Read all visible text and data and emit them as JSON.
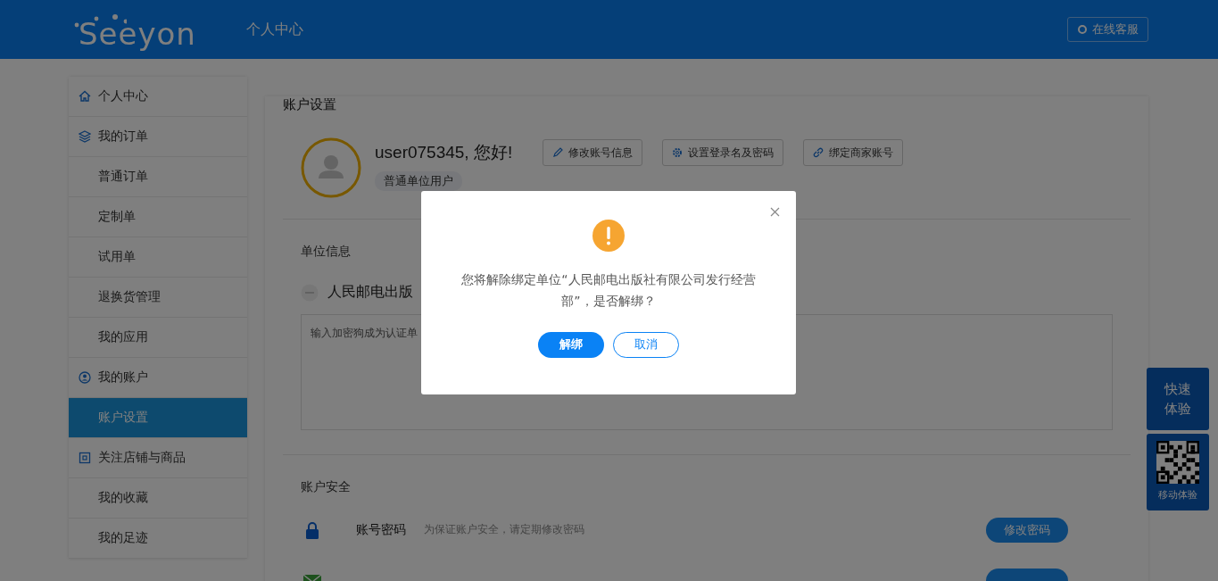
{
  "header": {
    "logo": "Seeyon",
    "title": "个人中心",
    "service_button": "在线客服"
  },
  "sidebar": {
    "items": [
      {
        "label": "个人中心",
        "kind": "group",
        "selected": false
      },
      {
        "label": "我的订单",
        "kind": "group",
        "selected": false
      },
      {
        "label": "普通订单",
        "kind": "item",
        "selected": false
      },
      {
        "label": "定制单",
        "kind": "item",
        "selected": false
      },
      {
        "label": "试用单",
        "kind": "item",
        "selected": false
      },
      {
        "label": "退换货管理",
        "kind": "item",
        "selected": false
      },
      {
        "label": "我的应用",
        "kind": "item",
        "selected": false
      },
      {
        "label": "我的账户",
        "kind": "group",
        "selected": false
      },
      {
        "label": "账户设置",
        "kind": "item",
        "selected": true
      },
      {
        "label": "关注店铺与商品",
        "kind": "group",
        "selected": false
      },
      {
        "label": "我的收藏",
        "kind": "item",
        "selected": false
      },
      {
        "label": "我的足迹",
        "kind": "item",
        "selected": false
      }
    ]
  },
  "account": {
    "title": "账户设置",
    "greeting": "user075345, 您好!",
    "role": "普通单位用户",
    "actions": [
      "修改账号信息",
      "设置登录名及密码",
      "绑定商家账号"
    ]
  },
  "unit": {
    "title": "单位信息",
    "name": "人民邮电出版",
    "dongle_hint": "输入加密狗成为认证单"
  },
  "security": {
    "title": "账户安全",
    "rows": [
      {
        "kind": "password",
        "label": "账号密码",
        "description": "为保证账户安全，请定期修改密码",
        "button": "修改密码"
      },
      {
        "kind": "email"
      }
    ]
  },
  "dialog": {
    "message": "您将解除绑定单位“人民邮电出版社有限公司发行经营部”，是否解绑？",
    "confirm": "解绑",
    "cancel": "取消"
  },
  "float_tools": {
    "quick": "快速体验",
    "mobile": "移动体验"
  }
}
